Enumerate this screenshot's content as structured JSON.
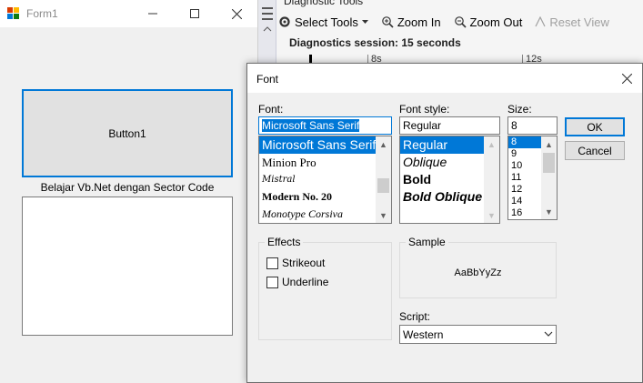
{
  "form1": {
    "title": "Form1",
    "button1_label": "Button1",
    "label_text": "Belajar Vb.Net dengan Sector Code",
    "app_icon": "winforms-app-icon",
    "caption_icons": [
      "minimize-icon",
      "maximize-icon",
      "close-icon"
    ]
  },
  "vs": {
    "pane_title": "Diagnostic Tools",
    "toolbar": {
      "select_tools": "Select Tools",
      "zoom_in": "Zoom In",
      "zoom_out": "Zoom Out",
      "reset_view": "Reset View"
    },
    "session": "Diagnostics session: 15 seconds",
    "ruler": [
      "8s",
      "12s"
    ]
  },
  "font_dialog": {
    "title": "Font",
    "font_label": "Font:",
    "font_value": "Microsoft Sans Serif",
    "fonts": [
      "Microsoft Sans Serif",
      "Minion Pro",
      "Mistral",
      "Modern No. 20",
      "Monotype Corsiva"
    ],
    "selected_font_index": 0,
    "style_label": "Font style:",
    "style_value": "Regular",
    "styles": [
      "Regular",
      "Oblique",
      "Bold",
      "Bold Oblique"
    ],
    "selected_style_index": 0,
    "size_label": "Size:",
    "size_value": "8",
    "sizes": [
      "8",
      "9",
      "10",
      "11",
      "12",
      "14",
      "16"
    ],
    "selected_size_index": 0,
    "ok_label": "OK",
    "cancel_label": "Cancel",
    "effects_label": "Effects",
    "strikeout_label": "Strikeout",
    "underline_label": "Underline",
    "strikeout_checked": false,
    "underline_checked": false,
    "sample_label": "Sample",
    "sample_text": "AaBbYyZz",
    "script_label": "Script:",
    "script_value": "Western"
  },
  "colors": {
    "accent": "#0078d7",
    "window_bg": "#f0f0f0",
    "button_bg": "#e1e1e1"
  }
}
